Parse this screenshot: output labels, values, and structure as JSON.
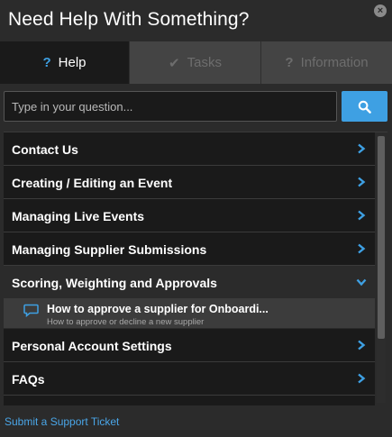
{
  "header": {
    "title": "Need Help With Something?",
    "close_icon": "close-icon"
  },
  "tabs": [
    {
      "label": "Help",
      "icon": "question-icon",
      "active": true
    },
    {
      "label": "Tasks",
      "icon": "check-icon",
      "active": false
    },
    {
      "label": "Information",
      "icon": "question-icon",
      "active": false
    }
  ],
  "search": {
    "placeholder": "Type in your question...",
    "value": "",
    "button_icon": "search-icon"
  },
  "categories": [
    {
      "label": "Contact Us"
    },
    {
      "label": "Creating / Editing an Event"
    },
    {
      "label": "Managing Live Events"
    },
    {
      "label": "Managing Supplier Submissions"
    },
    {
      "label": "Scoring, Weighting and Approvals",
      "expanded": true,
      "articles": [
        {
          "title": "How to approve a supplier for Onboardi...",
          "description": "How to approve or decline a new supplier"
        }
      ]
    },
    {
      "label": "Personal Account Settings"
    },
    {
      "label": "FAQs"
    }
  ],
  "footer": {
    "link_label": "Submit a Support Ticket"
  },
  "colors": {
    "accent": "#3ea0e3",
    "background": "#2b2b2b",
    "row": "#1a1a1a",
    "link": "#4aa6e8"
  }
}
